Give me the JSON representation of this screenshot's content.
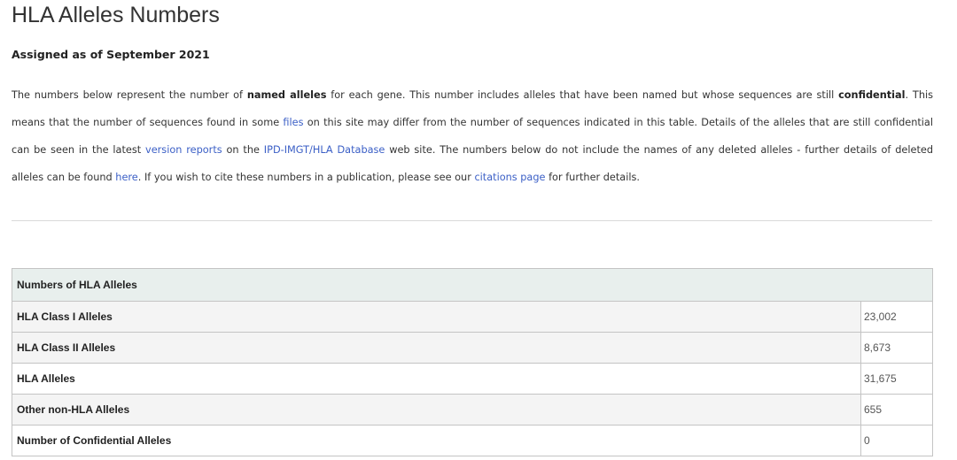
{
  "page": {
    "title": "HLA Alleles Numbers",
    "subtitle": "Assigned as of September 2021"
  },
  "intro": {
    "p1": "The numbers below represent the number of ",
    "b1": "named alleles",
    "p2": " for each gene. This number includes alleles that have been named but whose sequences are still ",
    "b2": "confidential",
    "p3": ". This means that the number of sequences found in some ",
    "link_files": "files",
    "p4": " on this site may differ from the number of sequences indicated in this table. Details of the alleles that are still confidential can be seen in the latest ",
    "link_version_reports": "version reports",
    "p5": " on the ",
    "link_database": "IPD-IMGT/HLA Database",
    "p6": " web site. The numbers below do not include the names of any deleted alleles - further details of deleted alleles can be found ",
    "link_here": "here",
    "p7": ". If you wish to cite these numbers in a publication, please see our ",
    "link_citations": "citations page",
    "p8": " for further details."
  },
  "table": {
    "header": "Numbers of HLA Alleles",
    "rows": [
      {
        "label": "HLA Class I Alleles",
        "value": "23,002"
      },
      {
        "label": "HLA Class II Alleles",
        "value": "8,673"
      },
      {
        "label": "HLA Alleles",
        "value": "31,675"
      },
      {
        "label": "Other non-HLA Alleles",
        "value": "655"
      },
      {
        "label": "Number of Confidential Alleles",
        "value": "0"
      }
    ]
  },
  "colors": {
    "link": "#3b5fc6",
    "header_bg": "#e8efed",
    "row_alt_bg": "#f4f4f4"
  }
}
